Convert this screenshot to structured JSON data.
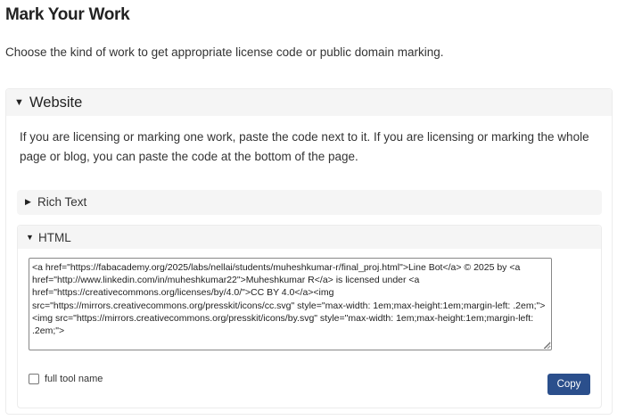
{
  "page": {
    "title": "Mark Your Work",
    "intro": "Choose the kind of work to get appropriate license code or public domain marking."
  },
  "website": {
    "expanded_icon": "triangle-down-icon",
    "title": "Website",
    "description": "If you are licensing or marking one work, paste the code next to it. If you are licensing or marking the whole page or blog, you can paste the code at the bottom of the page."
  },
  "rich_text": {
    "collapsed_icon": "triangle-right-icon",
    "title": "Rich Text"
  },
  "html_section": {
    "expanded_icon": "triangle-down-icon",
    "title": "HTML",
    "code": "<a href=\"https://fabacademy.org/2025/labs/nellai/students/muheshkumar-r/final_proj.html\">Line Bot</a> © 2025 by <a href=\"http://www.linkedin.com/in/muheshkumar22\">Muheshkumar R</a> is licensed under <a href=\"https://creativecommons.org/licenses/by/4.0/\">CC BY 4.0</a><img src=\"https://mirrors.creativecommons.org/presskit/icons/cc.svg\" style=\"max-width: 1em;max-height:1em;margin-left: .2em;\"><img src=\"https://mirrors.creativecommons.org/presskit/icons/by.svg\" style=\"max-width: 1em;max-height:1em;margin-left: .2em;\">",
    "full_tool_name_label": "full tool name",
    "full_tool_name_checked": false,
    "copy_label": "Copy"
  },
  "colors": {
    "copy_button": "#2b4f8c",
    "panel_header": "#f5f5f5"
  }
}
